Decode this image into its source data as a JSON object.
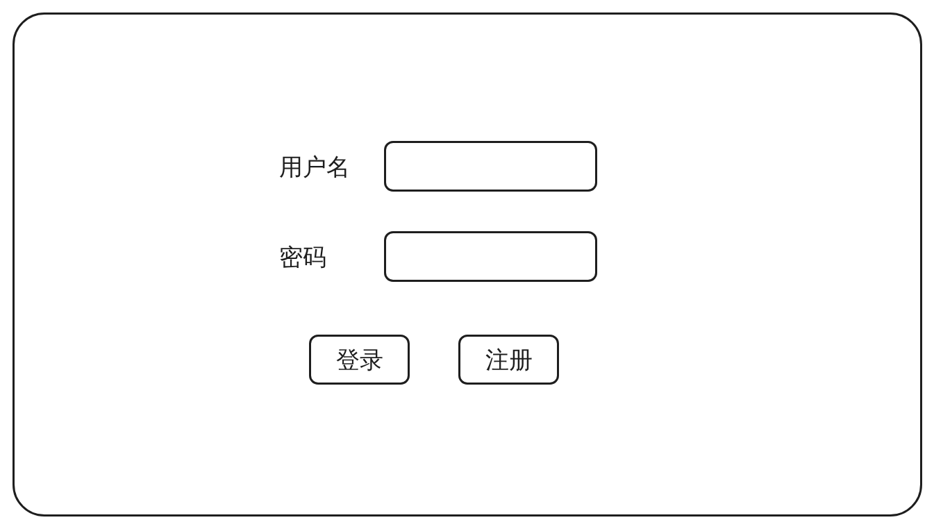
{
  "form": {
    "fields": [
      {
        "label": "用户名"
      },
      {
        "label": "密码"
      }
    ],
    "buttons": [
      {
        "label": "登录"
      },
      {
        "label": "注册"
      }
    ]
  }
}
